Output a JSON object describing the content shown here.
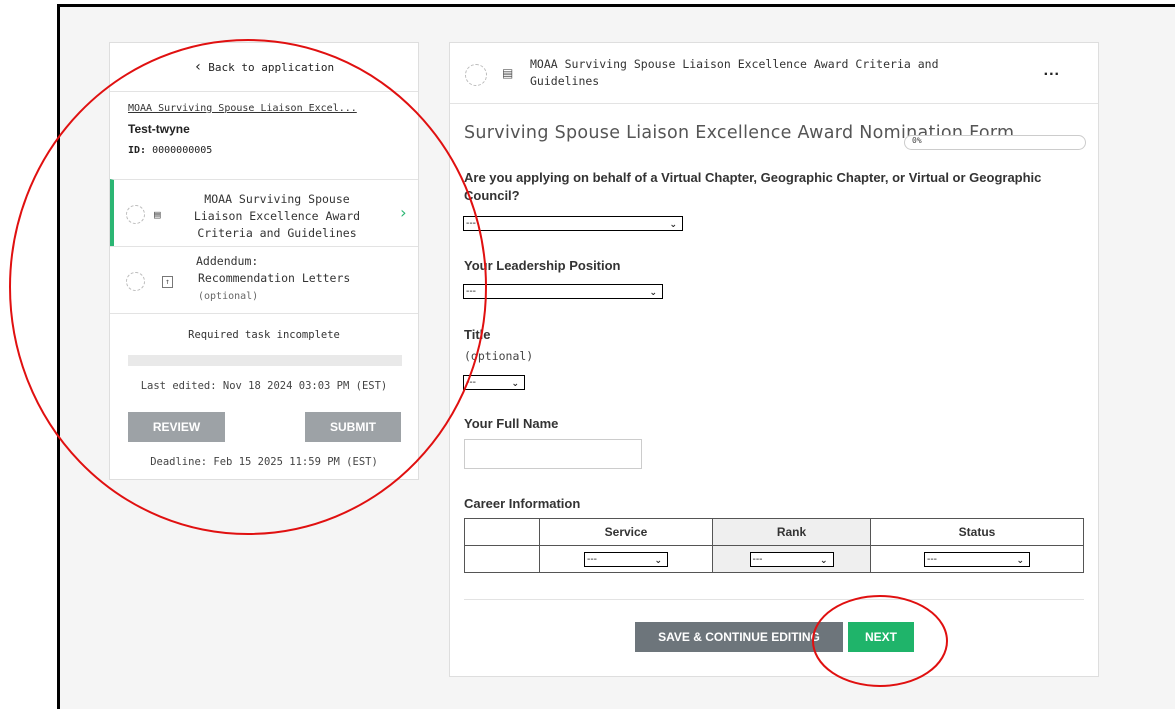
{
  "sidebar": {
    "back_label": "Back to application",
    "application_name": "MOAA Surviving Spouse Liaison Excel...",
    "applicant": "Test-twyne",
    "id_label": "ID:",
    "id_value": "0000000005",
    "tasks": [
      {
        "line1": "MOAA Surviving Spouse",
        "line2": "Liaison Excellence Award",
        "line3": "Criteria and Guidelines",
        "active": true
      },
      {
        "line1": "Addendum:",
        "line2": "Recommendation Letters",
        "optional": "(optional)",
        "active": false
      }
    ],
    "status_text": "Required task incomplete",
    "progress_fraction": 0,
    "last_edited": "Last edited: Nov 18 2024 03:03 PM (EST)",
    "review_label": "REVIEW",
    "submit_label": "SUBMIT",
    "deadline": "Deadline: Feb 15 2025 11:59 PM (EST)"
  },
  "main": {
    "header_title": "MOAA Surviving Spouse Liaison Excellence Award Criteria and Guidelines",
    "more_label": "...",
    "form_title": "Surviving Spouse Liaison Excellence Award Nomination Form",
    "completion": "0%",
    "questions": [
      {
        "label": "Are you applying on behalf of a Virtual Chapter, Geographic Chapter, or Virtual or Geographic Council?",
        "value": "---"
      },
      {
        "label": "Your Leadership Position",
        "value": "---"
      },
      {
        "label": "Title",
        "optional": "(optional)",
        "value": "---"
      },
      {
        "label": "Your Full Name",
        "value": ""
      }
    ],
    "career": {
      "label": "Career Information",
      "columns": [
        "Service",
        "Rank",
        "Status"
      ],
      "values": [
        "---",
        "---",
        "---"
      ]
    },
    "save_label": "SAVE & CONTINUE EDITING",
    "next_label": "NEXT"
  },
  "colors": {
    "accent_green": "#1fb46a",
    "annotation_red": "#e01010",
    "button_gray": "#9da2a6"
  }
}
